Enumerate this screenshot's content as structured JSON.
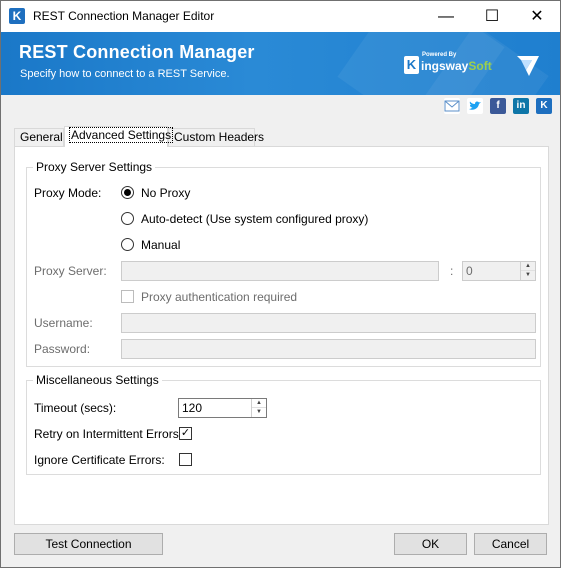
{
  "window": {
    "title": "REST Connection Manager Editor",
    "minimize": "—",
    "maximize": "☐",
    "close": "✕",
    "app_icon": "K"
  },
  "banner": {
    "title": "REST Connection Manager",
    "subtitle": "Specify how to connect to a REST Service.",
    "powered_by": "Powered By",
    "brand_k": "K",
    "brand_name_a": "ingsway",
    "brand_name_b": "Soft"
  },
  "social": {
    "email_icon": "email-icon",
    "twitter_icon": "twitter-icon",
    "facebook": "f",
    "linkedin": "in",
    "kingsway": "K"
  },
  "tabs": [
    {
      "label": "General"
    },
    {
      "label": "Advanced Settings",
      "active": true
    },
    {
      "label": "Custom Headers"
    }
  ],
  "proxy": {
    "group_title": "Proxy Server Settings",
    "mode_label": "Proxy Mode:",
    "options": [
      "No Proxy",
      "Auto-detect (Use system configured proxy)",
      "Manual"
    ],
    "selected": "No Proxy",
    "server_label": "Proxy Server:",
    "server_value": "",
    "port_sep": ":",
    "port_value": "0",
    "auth_label": "Proxy authentication required",
    "username_label": "Username:",
    "username_value": "",
    "password_label": "Password:",
    "password_value": ""
  },
  "misc": {
    "group_title": "Miscellaneous Settings",
    "timeout_label": "Timeout (secs):",
    "timeout_value": "120",
    "retry_label": "Retry on Intermittent Errors:",
    "retry_checked": true,
    "ignore_cert_label": "Ignore Certificate Errors:",
    "ignore_cert_checked": false,
    "check_mark": "✓"
  },
  "buttons": {
    "test": "Test Connection",
    "ok": "OK",
    "cancel": "Cancel"
  },
  "colors": {
    "banner": "#1a78c8",
    "accent_green": "#9ed04a"
  }
}
